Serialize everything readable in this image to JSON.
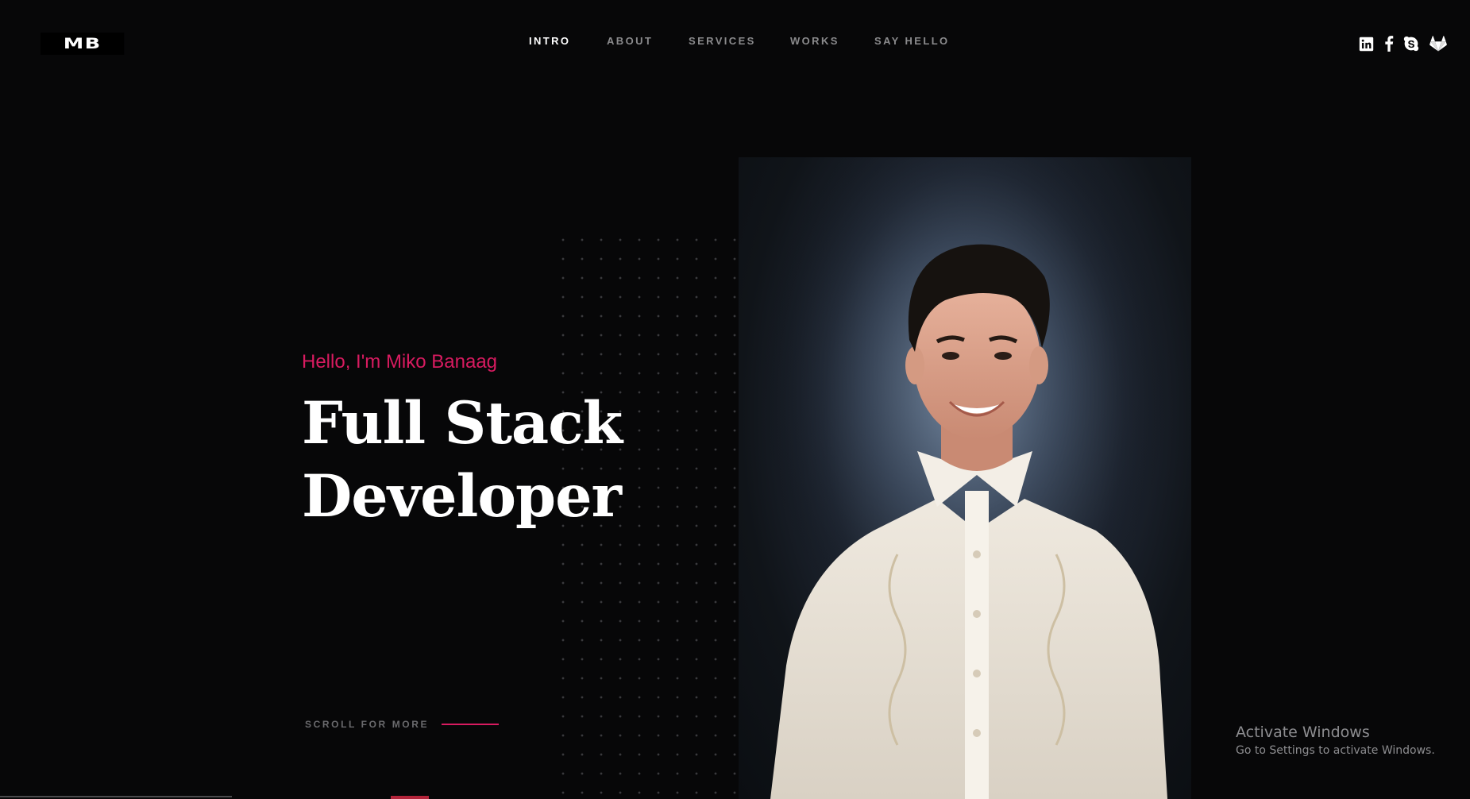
{
  "header": {
    "logo_text": "MB",
    "nav": [
      {
        "label": "INTRO",
        "active": true
      },
      {
        "label": "ABOUT",
        "active": false
      },
      {
        "label": "SERVICES",
        "active": false
      },
      {
        "label": "WORKS",
        "active": false
      },
      {
        "label": "SAY HELLO",
        "active": false
      }
    ],
    "social_icons": [
      "linkedin-icon",
      "facebook-icon",
      "skype-icon",
      "gitlab-icon"
    ]
  },
  "hero": {
    "greeting": "Hello, I'm Miko Banaag",
    "title_line1": "Full Stack",
    "title_line2": "Developer",
    "scroll_label": "SCROLL FOR MORE"
  },
  "watermark": {
    "title": "Activate Windows",
    "subtitle": "Go to Settings to activate Windows."
  },
  "colors": {
    "background": "#070708",
    "accent": "#d81b60",
    "nav_inactive": "#8b8b8d",
    "nav_active": "#ffffff"
  }
}
